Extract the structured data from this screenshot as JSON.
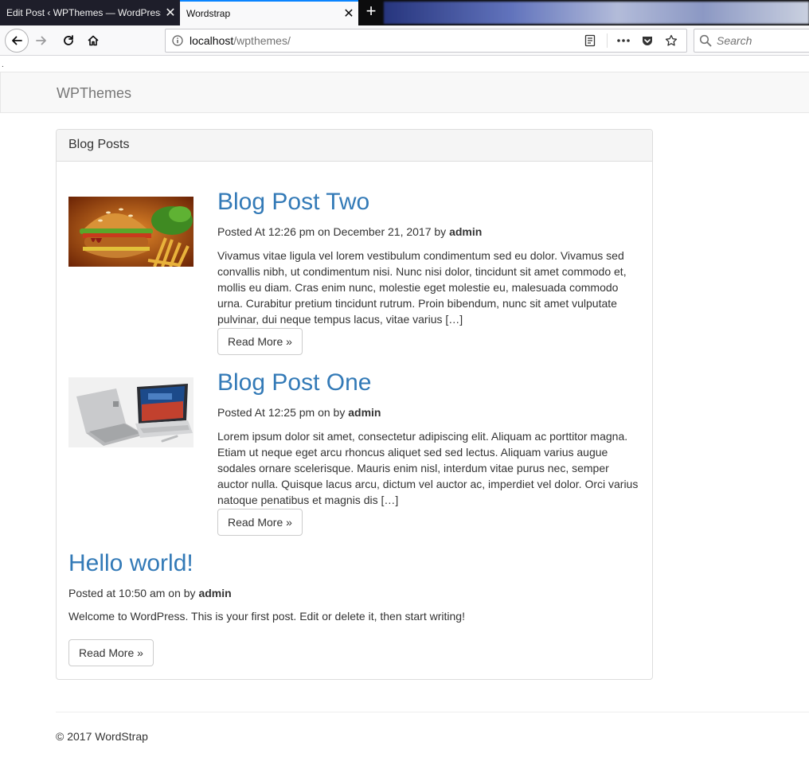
{
  "browser": {
    "tabs": [
      {
        "title": "Edit Post ‹ WPThemes — WordPress",
        "active": false
      },
      {
        "title": "Wordstrap",
        "active": true
      }
    ],
    "url_host": "localhost",
    "url_path": "/wpthemes/",
    "search_placeholder": "Search"
  },
  "site": {
    "dot": ".",
    "brand": "WPThemes"
  },
  "panel": {
    "heading": "Blog Posts"
  },
  "posts": [
    {
      "title": "Blog Post Two",
      "meta_prefix": "Posted At 12:26 pm on December 21, 2017 by ",
      "author": "admin",
      "excerpt": "Vivamus vitae ligula vel lorem vestibulum condimentum sed eu dolor. Vivamus sed convallis nibh, ut condimentum nisi. Nunc nisi dolor, tincidunt sit amet commodo et, mollis eu diam. Cras enim nunc, molestie eget molestie eu, malesuada commodo urna. Curabitur pretium tincidunt rutrum. Proin bibendum, nunc sit amet vulputate pulvinar, dui neque tempus lacus, vitae varius […]",
      "read_more": "Read More »"
    },
    {
      "title": "Blog Post One",
      "meta_prefix": "Posted At 12:25 pm on by ",
      "author": "admin",
      "excerpt": "Lorem ipsum dolor sit amet, consectetur adipiscing elit. Aliquam ac porttitor magna. Etiam ut neque eget arcu rhoncus aliquet sed sed lectus. Aliquam varius augue sodales ornare scelerisque. Mauris enim nisl, interdum vitae purus nec, semper auctor nulla. Quisque lacus arcu, dictum vel auctor ac, imperdiet vel dolor. Orci varius natoque penatibus et magnis dis […]",
      "read_more": "Read More »"
    },
    {
      "title": "Hello world!",
      "meta_prefix": "Posted at 10:50 am on by ",
      "author": "admin",
      "excerpt": "Welcome to WordPress. This is your first post. Edit or delete it, then start writing!",
      "read_more": "Read More »"
    }
  ],
  "footer": {
    "copyright": "© 2017 WordStrap"
  },
  "colors": {
    "link": "#337ab7",
    "tab_accent": "#0a84ff"
  },
  "icons": [
    "back-icon",
    "forward-icon",
    "reload-icon",
    "home-icon",
    "info-icon",
    "reader-view-icon",
    "more-actions-icon",
    "pocket-icon",
    "bookmark-star-icon",
    "search-icon",
    "close-icon",
    "plus-icon"
  ]
}
